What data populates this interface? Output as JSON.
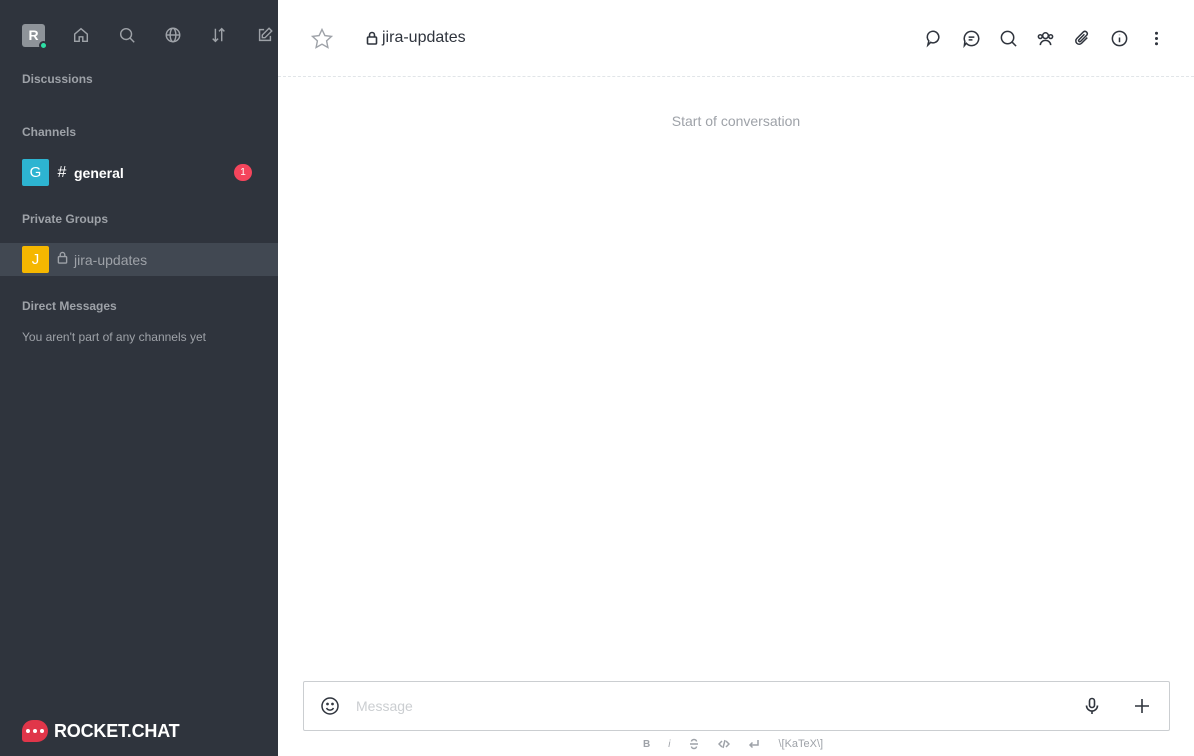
{
  "sidebar": {
    "user_avatar_letter": "R",
    "user_status_color": "#2de0a5",
    "top_icons": [
      "home-icon",
      "search-icon",
      "directory-globe-icon",
      "sort-icon",
      "create-new-icon"
    ],
    "sections": {
      "discussions": "Discussions",
      "channels": "Channels",
      "private_groups": "Private Groups",
      "direct_messages": "Direct Messages"
    },
    "channels": [
      {
        "avatar_letter": "G",
        "avatar_color": "#2db4d1",
        "type_symbol": "#",
        "name": "general",
        "unread": "1"
      }
    ],
    "private_groups": [
      {
        "avatar_letter": "J",
        "avatar_color": "#f5b700",
        "name": "jira-updates",
        "active": true
      }
    ],
    "direct_messages_empty": "You aren't part of any channels yet",
    "logo_text": "ROCKET.CHAT",
    "bg_color": "#2f343d"
  },
  "header": {
    "room_name": "jira-updates",
    "icons": [
      "threads-icon",
      "discussion-icon",
      "search-messages-icon",
      "members-icon",
      "files-attachment-icon",
      "room-info-icon",
      "kebab-menu-icon"
    ]
  },
  "main": {
    "start_note": "Start of conversation"
  },
  "composer": {
    "placeholder": "Message",
    "value": "",
    "format_bar": [
      "B",
      "i",
      "S",
      "</>",
      "↵",
      "\\[KaTeX\\]"
    ]
  },
  "colors": {
    "accent_red": "#f5455c",
    "text_dark": "#2f343d",
    "text_muted": "#9ea2a8"
  }
}
